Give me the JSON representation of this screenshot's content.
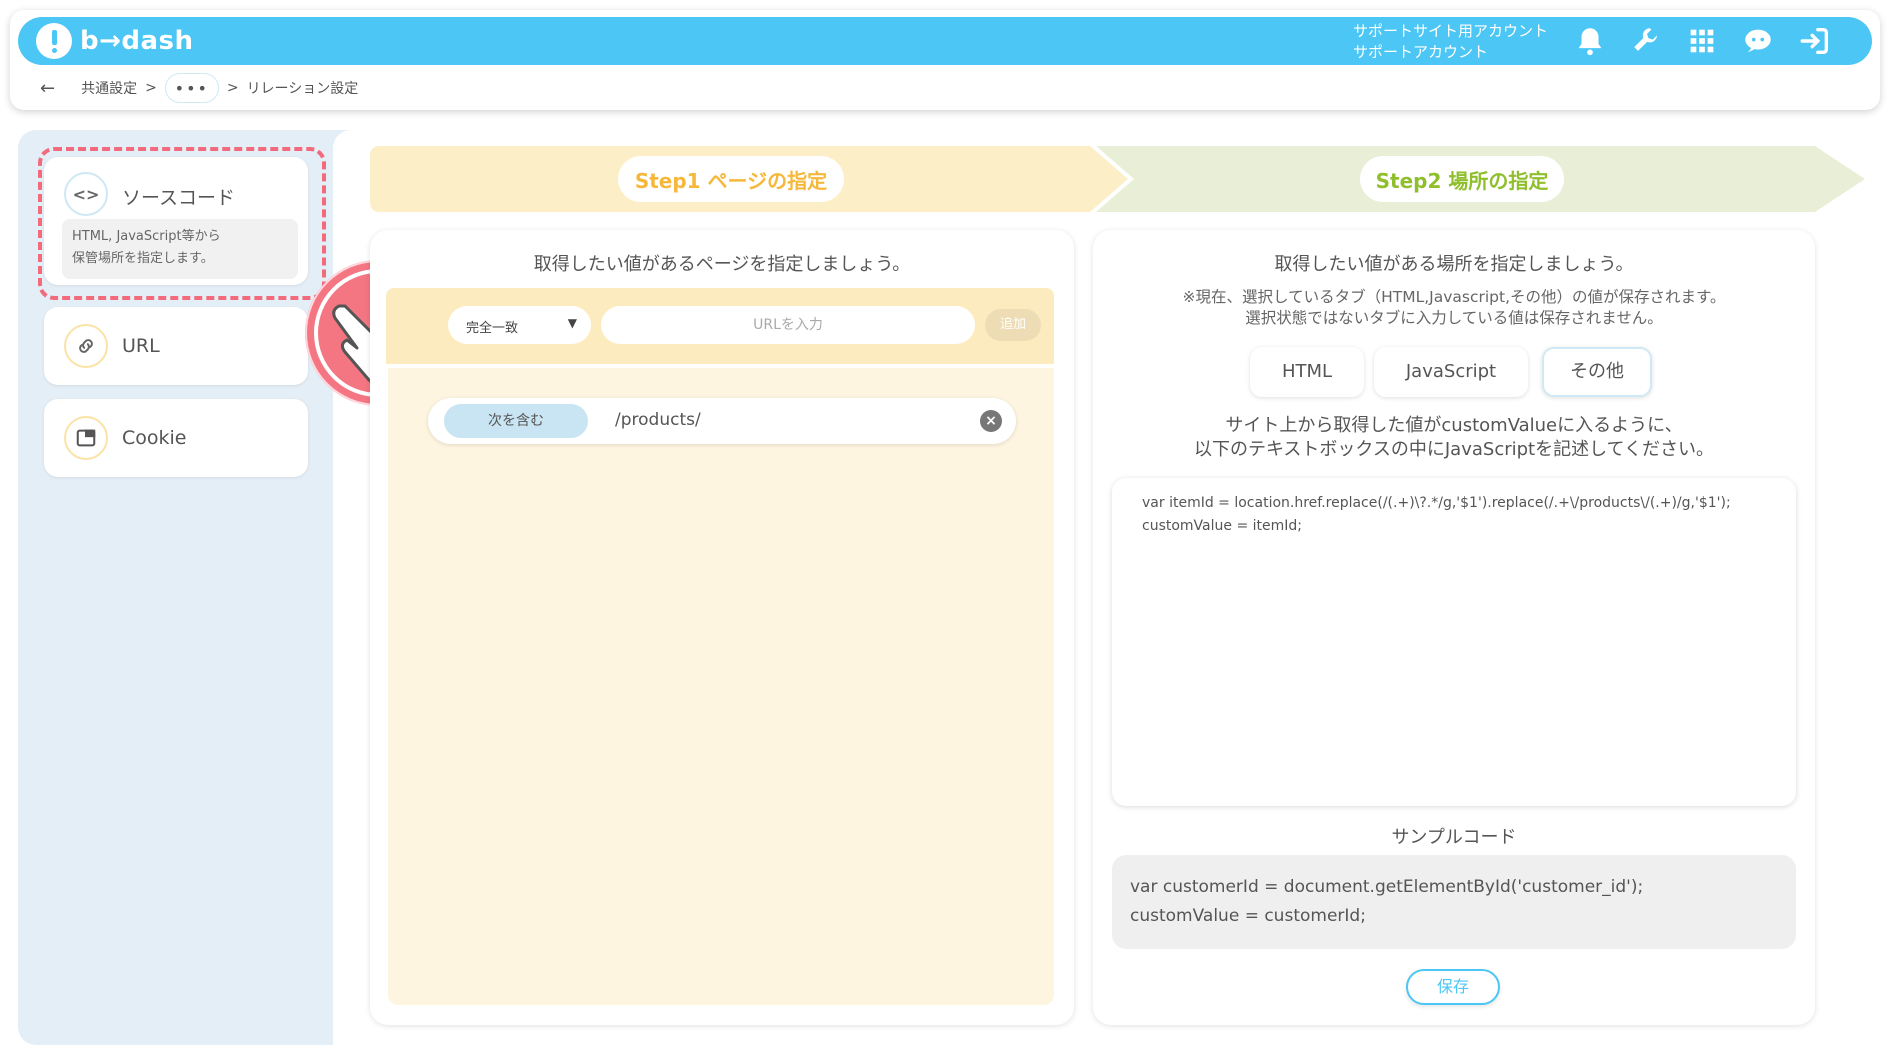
{
  "app": {
    "logo_text": "b→dash",
    "brand_color": "#4cc6f5"
  },
  "header": {
    "account_line1": "サポートサイト用アカウント",
    "account_line2": "サポートアカウント",
    "icons": [
      "bell-icon",
      "wrench-icon",
      "grid-icon",
      "chat-icon",
      "logout-icon"
    ]
  },
  "breadcrumb": {
    "back": "←",
    "item1": "共通設定",
    "sep": ">",
    "more": "•••",
    "current": "リレーション設定"
  },
  "sidebar": {
    "items": [
      {
        "label": "ソースコード",
        "icon": "code-icon",
        "icon_glyph": "<>",
        "description_line1": "HTML, JavaScript等から",
        "description_line2": "保管場所を指定します。"
      },
      {
        "label": "URL",
        "icon": "link-icon"
      },
      {
        "label": "Cookie",
        "icon": "window-icon"
      }
    ]
  },
  "steps": {
    "step1": "Step1 ページの指定",
    "step2": "Step2 場所の指定",
    "step1_color": "#f6b83a",
    "step2_color": "#8fbf2c"
  },
  "step1": {
    "title": "取得したい値があるページを指定しましょう。",
    "match_select": "完全一致",
    "url_placeholder": "URLを入力",
    "add_button": "追加",
    "rule_type": "次を含む",
    "rule_value": "/products/"
  },
  "step2": {
    "title": "取得したい値がある場所を指定しましょう。",
    "notice_line1": "※現在、選択しているタブ（HTML,Javascript,その他）の値が保存されます。",
    "notice_line2": "選択状態ではないタブに入力している値は保存されません。",
    "tabs": [
      "HTML",
      "JavaScript",
      "その他"
    ],
    "instruction_line1": "サイト上から取得した値がcustomValueに入るように、",
    "instruction_line2": "以下のテキストボックスの中にJavaScriptを記述してください。",
    "code": "var itemId = location.href.replace(/(.+)\\?.*/g,'$1').replace(/.+\\/products\\/(.+)/g,'$1');\ncustomValue = itemId;",
    "sample_title": "サンプルコード",
    "sample_code": "var customerId = document.getElementById('customer_id');\ncustomValue = customerId;",
    "save_button": "保存"
  }
}
